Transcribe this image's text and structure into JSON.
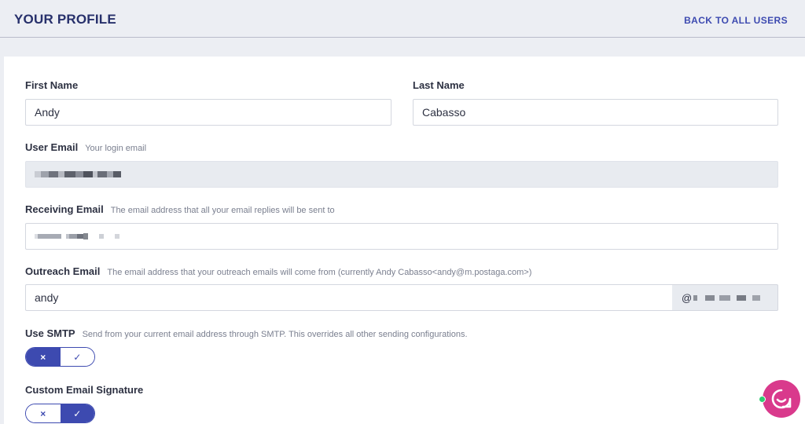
{
  "header": {
    "title": "YOUR PROFILE",
    "back_link": "BACK TO ALL USERS"
  },
  "form": {
    "first_name": {
      "label": "First Name",
      "value": "Andy"
    },
    "last_name": {
      "label": "Last Name",
      "value": "Cabasso"
    },
    "user_email": {
      "label": "User Email",
      "hint": "Your login email"
    },
    "receiving_email": {
      "label": "Receiving Email",
      "hint": "The email address that all your email replies will be sent to"
    },
    "outreach_email": {
      "label": "Outreach Email",
      "hint": "The email address that your outreach emails will come from (currently Andy Cabasso<andy@m.postaga.com>)",
      "value": "andy",
      "domain_prefix": "@"
    },
    "use_smtp": {
      "label": "Use SMTP",
      "hint": "Send from your current email address through SMTP. This overrides all other sending configurations.",
      "state": "off"
    },
    "custom_signature": {
      "label": "Custom Email Signature",
      "state": "on"
    }
  },
  "toggle_icons": {
    "off": "×",
    "on": "✓"
  },
  "icons": {
    "toggle_off": "x-icon",
    "toggle_on": "check-icon",
    "chat": "chat-bubble-icon"
  },
  "colors": {
    "accent": "#3d4ab0",
    "title": "#27306b",
    "chat": "#d93a8c",
    "online": "#2ecc71"
  }
}
